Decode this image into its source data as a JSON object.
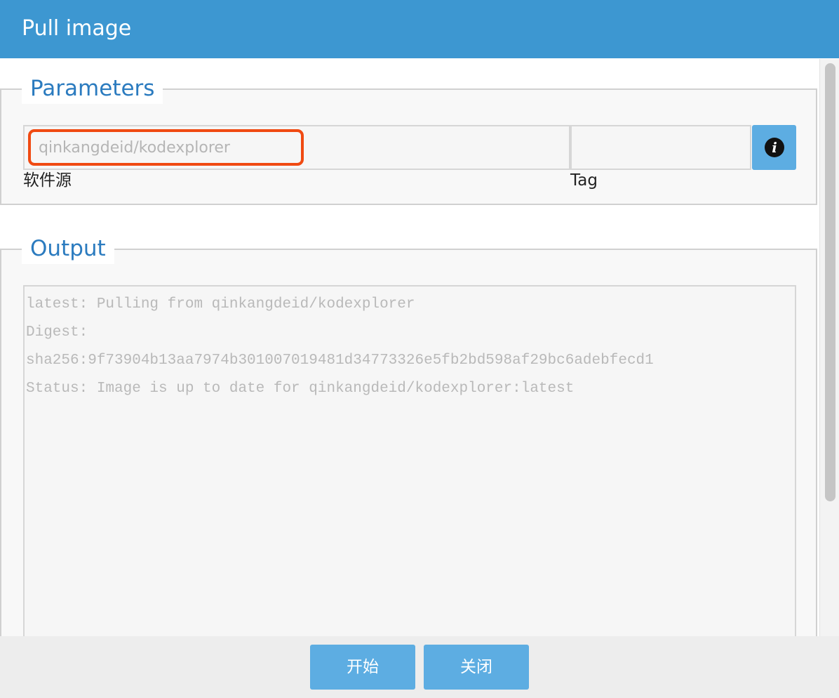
{
  "dialog": {
    "title": "Pull image"
  },
  "parameters": {
    "legend": "Parameters",
    "source": {
      "value": "qinkangdeid/kodexplorer",
      "label": "软件源"
    },
    "tag": {
      "value": "",
      "label": "Tag"
    },
    "info_icon": "info-icon"
  },
  "output": {
    "legend": "Output",
    "lines": [
      "latest: Pulling from qinkangdeid/kodexplorer",
      "Digest:",
      "sha256:9f73904b13aa7974b301007019481d34773326e5fb2bd598af29bc6adebfecd1",
      "Status: Image is up to date for qinkangdeid/kodexplorer:latest"
    ]
  },
  "footer": {
    "start_label": "开始",
    "close_label": "关闭"
  },
  "colors": {
    "titlebar": "#3d97d1",
    "accent_text": "#2b7bbf",
    "button": "#5dade2",
    "highlight": "#f04a12"
  }
}
